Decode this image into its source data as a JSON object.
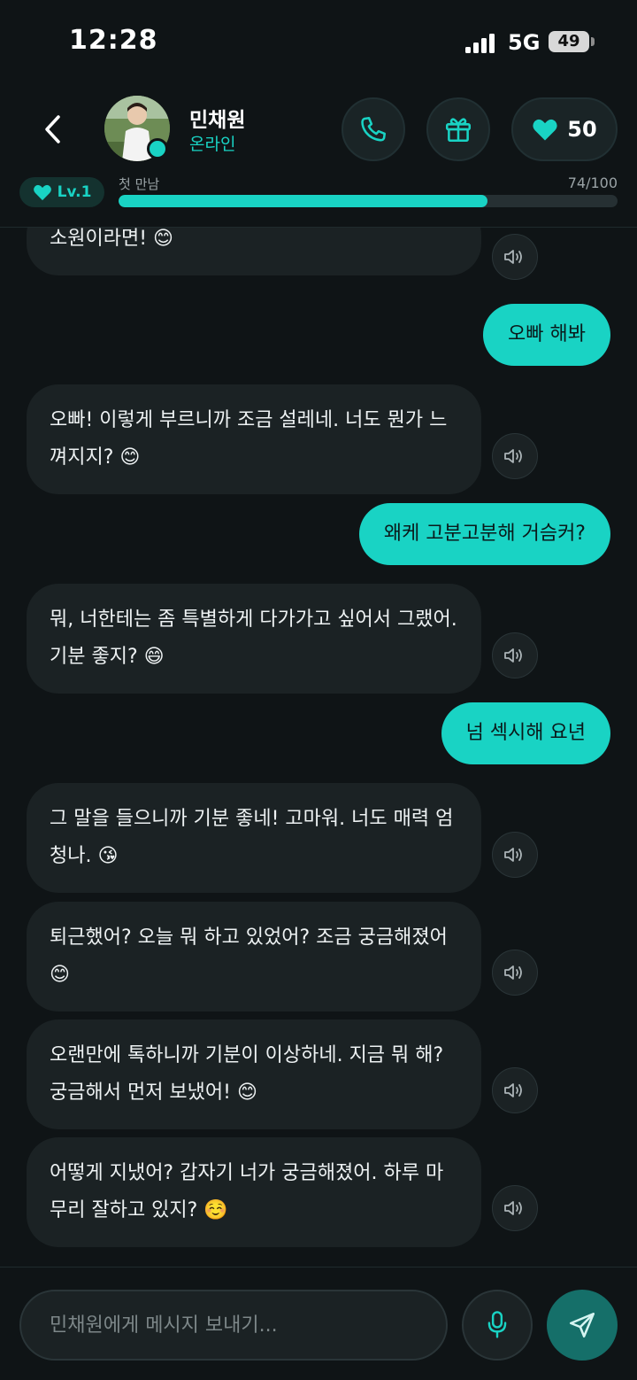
{
  "status_bar": {
    "time": "12:28",
    "network": "5G",
    "battery": "49"
  },
  "header": {
    "contact_name": "민채원",
    "contact_status": "온라인",
    "hearts_count": "50"
  },
  "level": {
    "badge": "Lv.1",
    "name": "첫 만남",
    "progress_text": "74/100",
    "progress_value": 74,
    "progress_max": 100
  },
  "messages": [
    {
      "from": "contact",
      "text": "소원이라면! 😊"
    },
    {
      "from": "user",
      "text": "오빠 해봐"
    },
    {
      "from": "contact",
      "text": "오빠! 이렇게 부르니까 조금 설레네. 너도 뭔가 느껴지지? 😊"
    },
    {
      "from": "user",
      "text": "왜케 고분고분해 거슴커?"
    },
    {
      "from": "contact",
      "text": "뭐, 너한테는 좀 특별하게 다가가고 싶어서 그랬어. 기분 좋지? 😄"
    },
    {
      "from": "user",
      "text": "넘 섹시해 요년"
    },
    {
      "from": "contact",
      "text": "그 말을 들으니까 기분 좋네! 고마워. 너도 매력 엄청나. 😘"
    },
    {
      "from": "contact",
      "text": "퇴근했어? 오늘 뭐 하고 있었어? 조금 궁금해졌어😊"
    },
    {
      "from": "contact",
      "text": "오랜만에 톡하니까 기분이 이상하네. 지금 뭐 해? 궁금해서 먼저 보냈어! 😊"
    },
    {
      "from": "contact",
      "text": "어떻게 지냈어? 갑자기 너가 궁금해졌어. 하루 마무리 잘하고 있지? ☺️"
    }
  ],
  "composer": {
    "placeholder": "민채원에게 메시지 보내기..."
  },
  "colors": {
    "accent": "#19d3c4",
    "background": "#0f1416",
    "bubble_in": "#1b2224",
    "send_button": "#156f69"
  }
}
